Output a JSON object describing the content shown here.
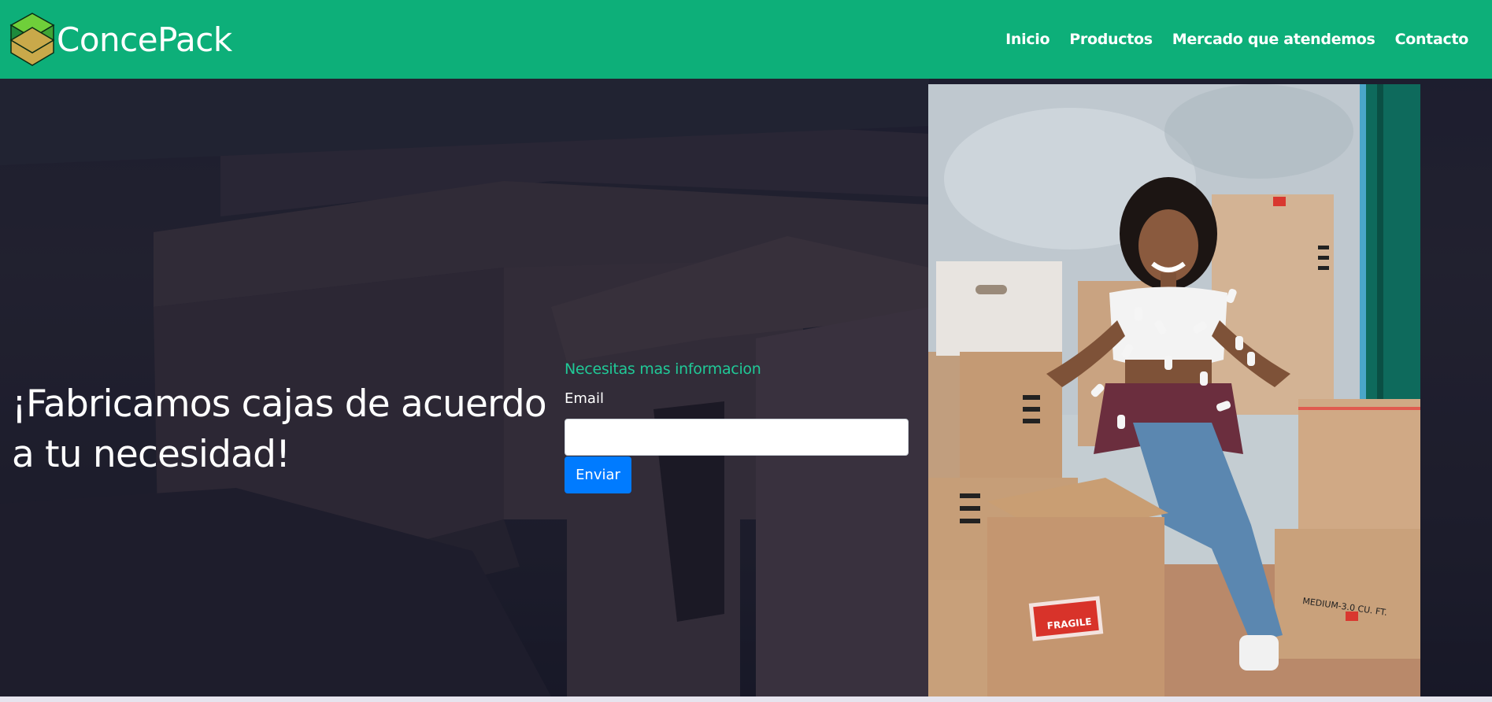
{
  "brand": {
    "name": "ConcePack",
    "colors": {
      "top": "#6fcf3a",
      "left": "#1e8a3c",
      "right": "#3fa535",
      "bottom": "#c9a94a"
    }
  },
  "nav": {
    "items": [
      {
        "label": "Inicio"
      },
      {
        "label": "Productos"
      },
      {
        "label": "Mercado que atendemos"
      },
      {
        "label": "Contacto"
      }
    ]
  },
  "hero": {
    "headline_line1": "¡Fabricamos cajas de acuerdo",
    "headline_line2": "a tu necesidad!"
  },
  "form": {
    "title": "Necesitas mas informacion",
    "email_label": "Email",
    "email_value": "",
    "email_placeholder": "",
    "submit_label": "Enviar"
  },
  "photo": {
    "subject": "woman-with-boxes-photo",
    "fragile_label": "FRAGILE",
    "box_print": "MEDIUM-3.0 CU. FT."
  },
  "colors": {
    "navbar": "#0daf79",
    "accent": "#20c997",
    "button": "#007bff"
  }
}
